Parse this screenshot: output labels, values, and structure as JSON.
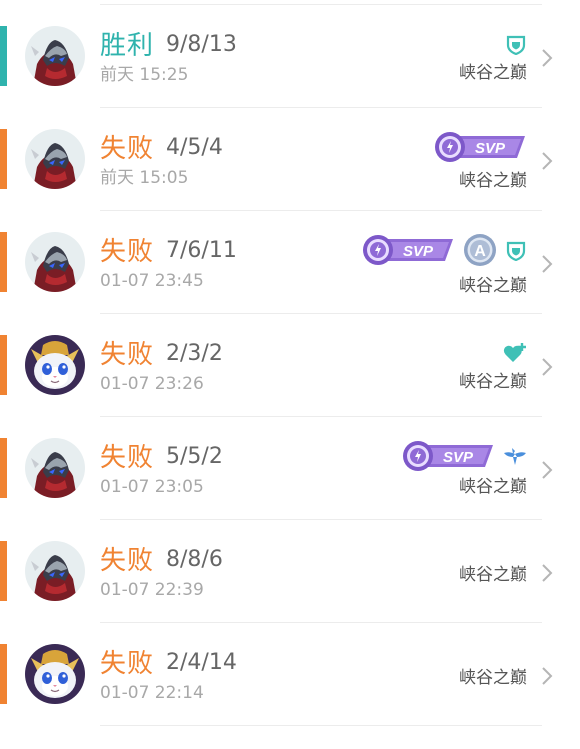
{
  "colors": {
    "win": "#2fb3ad",
    "loss": "#f08332",
    "svp_purple": "#8f6ad6",
    "teal_icon": "#3fc0b6",
    "blue_icon": "#4a8fdc"
  },
  "matches": [
    {
      "result": "胜利",
      "kda": "9/8/13",
      "time": "前天 15:25",
      "mode": "峡谷之巅",
      "avatar": "hero-dark-avatar",
      "badges": [
        "shield-icon"
      ]
    },
    {
      "result": "失败",
      "kda": "4/5/4",
      "time": "前天 15:05",
      "mode": "峡谷之巅",
      "avatar": "hero-dark-avatar",
      "badges": [
        "svp-badge"
      ],
      "svp": "SVP"
    },
    {
      "result": "失败",
      "kda": "7/6/11",
      "time": "01-07 23:45",
      "mode": "峡谷之巅",
      "avatar": "hero-dark-avatar",
      "badges": [
        "svp-badge",
        "a-rank-badge",
        "shield-icon"
      ],
      "svp": "SVP",
      "rank": "A"
    },
    {
      "result": "失败",
      "kda": "2/3/2",
      "time": "01-07 23:26",
      "mode": "峡谷之巅",
      "avatar": "hero-cat-avatar",
      "badges": [
        "heart-plus-icon"
      ]
    },
    {
      "result": "失败",
      "kda": "5/5/2",
      "time": "01-07 23:05",
      "mode": "峡谷之巅",
      "avatar": "hero-dark-avatar",
      "badges": [
        "svp-badge",
        "wings-icon"
      ],
      "svp": "SVP"
    },
    {
      "result": "失败",
      "kda": "8/8/6",
      "time": "01-07 22:39",
      "mode": "峡谷之巅",
      "avatar": "hero-dark-avatar",
      "badges": []
    },
    {
      "result": "失败",
      "kda": "2/4/14",
      "time": "01-07 22:14",
      "mode": "峡谷之巅",
      "avatar": "hero-cat-avatar",
      "badges": []
    }
  ]
}
